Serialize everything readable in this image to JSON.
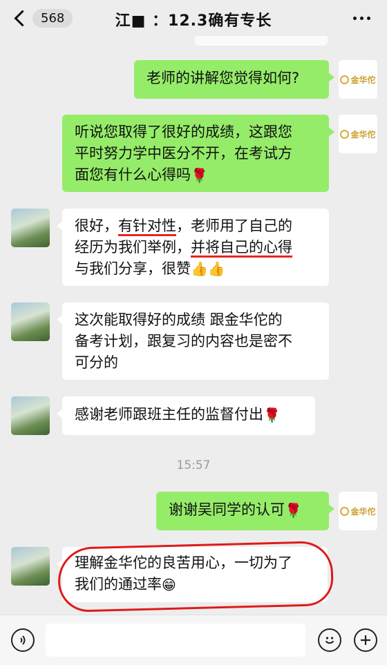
{
  "header": {
    "back_count": "568",
    "title": "江■ ：12.3确有专长"
  },
  "messages": [
    {
      "side": "right",
      "sender": "teacher",
      "lines": [
        "老师的讲解您觉得如何?"
      ]
    },
    {
      "side": "right",
      "sender": "teacher",
      "lines": [
        "听说您取得了很好的成绩，这跟您",
        "平时努力学中医分不开，在考试方",
        "面您有什么心得吗"
      ],
      "emoji": "rose"
    },
    {
      "side": "left",
      "sender": "student",
      "lines": [
        "很好，有针对性，老师用了自己的",
        "经历为我们举例，并将自己的心得",
        "与我们分享，很赞"
      ],
      "emoji": "thumbs-up x2"
    },
    {
      "side": "left",
      "sender": "student",
      "lines": [
        "这次能取得好的成绩 跟金华佗的",
        "备考计划，跟复习的内容也是密不",
        "可分的"
      ]
    },
    {
      "side": "left",
      "sender": "student",
      "lines": [
        "感谢老师跟班主任的监督付出"
      ],
      "emoji": "rose"
    },
    {
      "side": "right",
      "sender": "teacher",
      "lines": [
        "谢谢吴同学的认可"
      ],
      "emoji": "rose"
    },
    {
      "side": "left",
      "sender": "student",
      "lines": [
        "理解金华佗的良苦用心，一切为了",
        "我们的通过率"
      ],
      "emoji": "grin"
    }
  ],
  "timestamp": "15:57",
  "brand_avatar_text": "金华佗",
  "colors": {
    "green_bubble": "#95ec69",
    "annotation_red": "#e01a1a",
    "background": "#ededed"
  },
  "input_bar": {
    "voice_icon": "voice-icon",
    "emoji_icon": "emoji-icon",
    "plus_icon": "plus-icon"
  }
}
